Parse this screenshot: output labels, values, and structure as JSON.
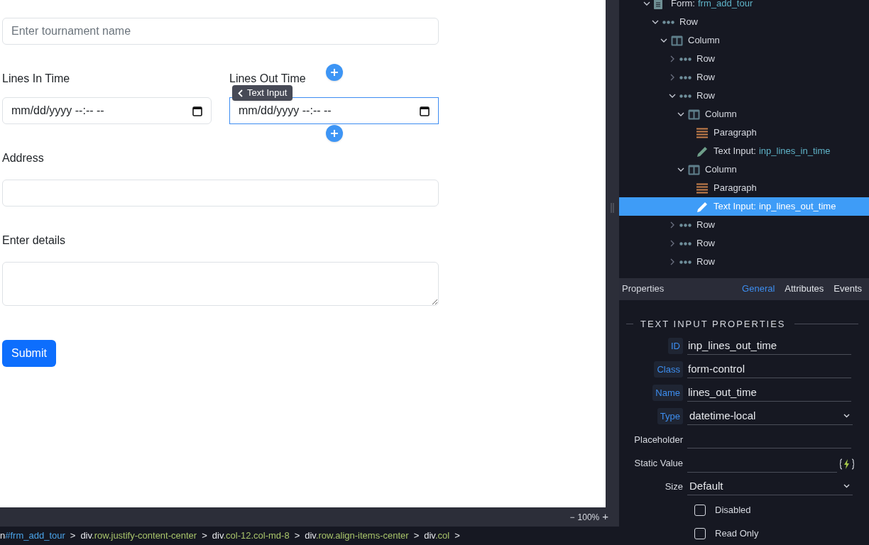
{
  "canvas": {
    "fields": [
      {
        "kind": "text",
        "placeholder": "Enter tournament name"
      },
      {
        "kind": "datetime-pair",
        "items": [
          {
            "label": "Lines In Time",
            "value": "mm/dd/yyyy --:--  --",
            "focused": false
          },
          {
            "label": "Lines Out Time",
            "value": "mm/dd/yyyy --:--  --",
            "focused": true
          }
        ]
      },
      {
        "kind": "labeled",
        "label": "Address"
      },
      {
        "kind": "textarea",
        "label": "Enter details"
      }
    ],
    "submit": "Submit",
    "tooltip": "Text Input"
  },
  "zoom": {
    "minus": "−",
    "level": "100%",
    "plus": "+"
  },
  "breadcrumb": [
    {
      "tag": "n",
      "selector": "#frm_add_tour",
      "kind": "id"
    },
    {
      "tag": "div",
      "selector": ".row.justify-content-center",
      "kind": "class"
    },
    {
      "tag": "div",
      "selector": ".col-12.col-md-8",
      "kind": "class"
    },
    {
      "tag": "div",
      "selector": ".row.align-items-center",
      "kind": "class"
    },
    {
      "tag": "div",
      "selector": ".col",
      "kind": "class"
    }
  ],
  "breadcrumb_separator": ">",
  "tree": [
    {
      "kind": "form",
      "label": "Form:",
      "value": "frm_add_tour",
      "expanded": true,
      "selected": false,
      "children": [
        {
          "kind": "row",
          "label": "Row",
          "expanded": true,
          "selected": false,
          "children": [
            {
              "kind": "column",
              "label": "Column",
              "expanded": true,
              "selected": false,
              "children": [
                {
                  "kind": "row",
                  "label": "Row",
                  "expanded": false,
                  "selected": false
                },
                {
                  "kind": "row",
                  "label": "Row",
                  "expanded": false,
                  "selected": false
                },
                {
                  "kind": "row",
                  "label": "Row",
                  "expanded": true,
                  "selected": false,
                  "children": [
                    {
                      "kind": "column",
                      "label": "Column",
                      "expanded": true,
                      "selected": false,
                      "children": [
                        {
                          "kind": "paragraph",
                          "label": "Paragraph",
                          "selected": false
                        },
                        {
                          "kind": "input",
                          "label": "Text Input:",
                          "value": "inp_lines_in_time",
                          "selected": false
                        }
                      ]
                    },
                    {
                      "kind": "column",
                      "label": "Column",
                      "expanded": true,
                      "selected": false,
                      "children": [
                        {
                          "kind": "paragraph",
                          "label": "Paragraph",
                          "selected": false
                        },
                        {
                          "kind": "input",
                          "label": "Text Input:",
                          "value": "inp_lines_out_time",
                          "selected": true
                        }
                      ]
                    }
                  ]
                },
                {
                  "kind": "row",
                  "label": "Row",
                  "expanded": false,
                  "selected": false
                },
                {
                  "kind": "row",
                  "label": "Row",
                  "expanded": false,
                  "selected": false
                },
                {
                  "kind": "row",
                  "label": "Row",
                  "expanded": false,
                  "selected": false
                }
              ]
            }
          ]
        }
      ]
    }
  ],
  "properties": {
    "title": "Properties",
    "tabs": [
      {
        "label": "General",
        "selected": true
      },
      {
        "label": "Attributes",
        "selected": false
      },
      {
        "label": "Events",
        "selected": false
      }
    ],
    "section": "TEXT INPUT PROPERTIES",
    "fields": [
      {
        "kind": "text",
        "label": "ID",
        "highlighted": true,
        "value": "inp_lines_out_time"
      },
      {
        "kind": "text",
        "label": "Class",
        "highlighted": true,
        "value": "form-control"
      },
      {
        "kind": "text",
        "label": "Name",
        "highlighted": true,
        "value": "lines_out_time"
      },
      {
        "kind": "select",
        "label": "Type",
        "highlighted": true,
        "value": "datetime-local"
      },
      {
        "kind": "text",
        "label": "Placeholder",
        "highlighted": false
      },
      {
        "kind": "dynamic",
        "label": "Static Value",
        "highlighted": false
      },
      {
        "kind": "select",
        "label": "Size",
        "highlighted": false,
        "value": "Default"
      },
      {
        "kind": "checkbox",
        "label": "Disabled",
        "checked": false
      },
      {
        "kind": "checkbox",
        "label": "Read Only",
        "checked": false
      }
    ]
  }
}
